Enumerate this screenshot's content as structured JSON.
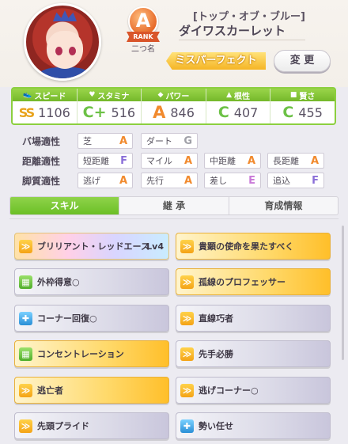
{
  "header": {
    "subtitle": "[トップ・オブ・ブルー]",
    "character_name": "ダイワスカーレット",
    "rank_grade": "A",
    "rank_word": "RANK",
    "rank_label": "二つ名",
    "evaluation": "ミスパーフェクト",
    "change_button": "変 更"
  },
  "stats": [
    {
      "label": "スピード",
      "grade": "SS",
      "value": "1106",
      "icon": "shoe-icon"
    },
    {
      "label": "スタミナ",
      "grade": "C+",
      "value": "516",
      "icon": "heart-icon"
    },
    {
      "label": "パワー",
      "grade": "A",
      "value": "846",
      "icon": "muscle-icon"
    },
    {
      "label": "根性",
      "grade": "C",
      "value": "407",
      "icon": "flame-icon"
    },
    {
      "label": "賢さ",
      "grade": "C",
      "value": "455",
      "icon": "graduation-cap-icon"
    }
  ],
  "aptitudes": {
    "track": {
      "label": "バ場適性",
      "items": [
        {
          "name": "芝",
          "grade": "A"
        },
        {
          "name": "ダート",
          "grade": "G"
        }
      ]
    },
    "distance": {
      "label": "距離適性",
      "items": [
        {
          "name": "短距離",
          "grade": "F"
        },
        {
          "name": "マイル",
          "grade": "A"
        },
        {
          "name": "中距離",
          "grade": "A"
        },
        {
          "name": "長距離",
          "grade": "A"
        }
      ]
    },
    "style": {
      "label": "脚質適性",
      "items": [
        {
          "name": "逃げ",
          "grade": "A"
        },
        {
          "name": "先行",
          "grade": "A"
        },
        {
          "name": "差し",
          "grade": "E"
        },
        {
          "name": "追込",
          "grade": "F"
        }
      ]
    }
  },
  "tabs": [
    "スキル",
    "継 承",
    "育成情報"
  ],
  "skills": [
    {
      "name": "ブリリアント・レッドエース",
      "level": "Lv4",
      "tier": "rainbow",
      "icon": "speed-up-icon"
    },
    {
      "name": "貴顕の使命を果たすべく",
      "level": "",
      "tier": "gold",
      "icon": "speed-up-icon"
    },
    {
      "name": "外枠得意○",
      "level": "",
      "tier": "normal",
      "icon": "field-icon"
    },
    {
      "name": "孤線のプロフェッサー",
      "level": "",
      "tier": "gold",
      "icon": "speed-up-icon"
    },
    {
      "name": "コーナー回復○",
      "level": "",
      "tier": "normal",
      "icon": "heal-icon"
    },
    {
      "name": "直線巧者",
      "level": "",
      "tier": "normal",
      "icon": "speed-up-icon"
    },
    {
      "name": "コンセントレーション",
      "level": "",
      "tier": "gold",
      "icon": "field-icon"
    },
    {
      "name": "先手必勝",
      "level": "",
      "tier": "normal",
      "icon": "speed-up-icon"
    },
    {
      "name": "逃亡者",
      "level": "",
      "tier": "gold",
      "icon": "speed-up-icon"
    },
    {
      "name": "逃げコーナー○",
      "level": "",
      "tier": "normal",
      "icon": "speed-up-icon"
    },
    {
      "name": "先頭プライド",
      "level": "",
      "tier": "normal",
      "icon": "speed-up-icon"
    },
    {
      "name": "勢い任せ",
      "level": "",
      "tier": "normal",
      "icon": "heal-icon"
    }
  ]
}
